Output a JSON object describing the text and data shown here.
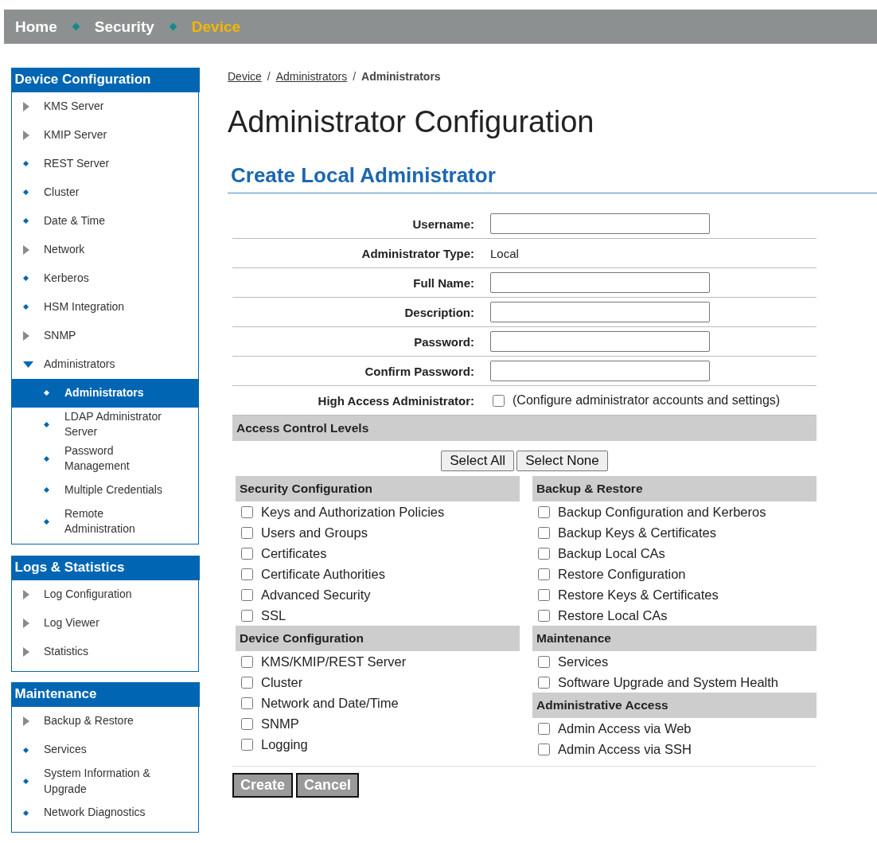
{
  "top_nav": [
    {
      "label": "Home",
      "selected": false
    },
    {
      "label": "Security",
      "selected": false
    },
    {
      "label": "Device",
      "selected": true
    }
  ],
  "sidebar": [
    {
      "title": "Device Configuration",
      "items": [
        {
          "label": "KMS Server",
          "kind": "arrow"
        },
        {
          "label": "KMIP Server",
          "kind": "arrow"
        },
        {
          "label": "REST Server",
          "kind": "bullet"
        },
        {
          "label": "Cluster",
          "kind": "bullet"
        },
        {
          "label": "Date & Time",
          "kind": "bullet"
        },
        {
          "label": "Network",
          "kind": "arrow"
        },
        {
          "label": "Kerberos",
          "kind": "bullet"
        },
        {
          "label": "HSM Integration",
          "kind": "bullet"
        },
        {
          "label": "SNMP",
          "kind": "arrow"
        },
        {
          "label": "Administrators",
          "kind": "expanded",
          "children": [
            {
              "label": "Administrators",
              "selected": true
            },
            {
              "label": "LDAP Administrator Server",
              "selected": false
            },
            {
              "label": "Password Management",
              "selected": false
            },
            {
              "label": "Multiple Credentials",
              "selected": false
            },
            {
              "label": "Remote Administration",
              "selected": false
            }
          ]
        }
      ]
    },
    {
      "title": "Logs & Statistics",
      "items": [
        {
          "label": "Log Configuration",
          "kind": "arrow"
        },
        {
          "label": "Log Viewer",
          "kind": "arrow"
        },
        {
          "label": "Statistics",
          "kind": "arrow"
        }
      ]
    },
    {
      "title": "Maintenance",
      "items": [
        {
          "label": "Backup & Restore",
          "kind": "arrow"
        },
        {
          "label": "Services",
          "kind": "bullet"
        },
        {
          "label": "System Information & Upgrade",
          "kind": "bullet"
        },
        {
          "label": "Network Diagnostics",
          "kind": "bullet"
        }
      ]
    }
  ],
  "breadcrumb_separator": "/",
  "breadcrumb": [
    {
      "label": "Device",
      "kind": "link"
    },
    {
      "label": "Administrators",
      "kind": "link"
    },
    {
      "label": "Administrators",
      "kind": "current"
    }
  ],
  "page_title": "Administrator Configuration",
  "section_title": "Create Local Administrator",
  "form": [
    {
      "label": "Username:",
      "kind": "input"
    },
    {
      "label": "Administrator Type:",
      "kind": "text",
      "value": "Local"
    },
    {
      "label": "Full Name:",
      "kind": "input"
    },
    {
      "label": "Description:",
      "kind": "input"
    },
    {
      "label": "Password:",
      "kind": "input"
    },
    {
      "label": "Confirm Password:",
      "kind": "input"
    },
    {
      "label": "High Access Administrator:",
      "kind": "checkbox",
      "checked": false,
      "note": "(Configure administrator accounts and settings)"
    }
  ],
  "access_header": "Access Control Levels",
  "select_buttons": [
    "Select All",
    "Select None"
  ],
  "access_columns": [
    [
      {
        "title": "Security Configuration",
        "options": [
          {
            "label": "Keys and Authorization Policies",
            "checked": false
          },
          {
            "label": "Users and Groups",
            "checked": false
          },
          {
            "label": "Certificates",
            "checked": false
          },
          {
            "label": "Certificate Authorities",
            "checked": false
          },
          {
            "label": "Advanced Security",
            "checked": false
          },
          {
            "label": "SSL",
            "checked": false
          }
        ]
      },
      {
        "title": "Device Configuration",
        "options": [
          {
            "label": "KMS/KMIP/REST Server",
            "checked": false
          },
          {
            "label": "Cluster",
            "checked": false
          },
          {
            "label": "Network and Date/Time",
            "checked": false
          },
          {
            "label": "SNMP",
            "checked": false
          },
          {
            "label": "Logging",
            "checked": false
          }
        ]
      }
    ],
    [
      {
        "title": "Backup & Restore",
        "options": [
          {
            "label": "Backup Configuration and Kerberos",
            "checked": false
          },
          {
            "label": "Backup Keys & Certificates",
            "checked": false
          },
          {
            "label": "Backup Local CAs",
            "checked": false
          },
          {
            "label": "Restore Configuration",
            "checked": false
          },
          {
            "label": "Restore Keys & Certificates",
            "checked": false
          },
          {
            "label": "Restore Local CAs",
            "checked": false
          }
        ]
      },
      {
        "title": "Maintenance",
        "options": [
          {
            "label": "Services",
            "checked": false
          },
          {
            "label": "Software Upgrade and System Health",
            "checked": false
          }
        ]
      },
      {
        "title": "Administrative Access",
        "options": [
          {
            "label": "Admin Access via Web",
            "checked": false
          },
          {
            "label": "Admin Access via SSH",
            "checked": false
          }
        ]
      }
    ]
  ],
  "actions": [
    {
      "label": "Create",
      "disabled": true
    },
    {
      "label": "Cancel",
      "disabled": true
    }
  ]
}
